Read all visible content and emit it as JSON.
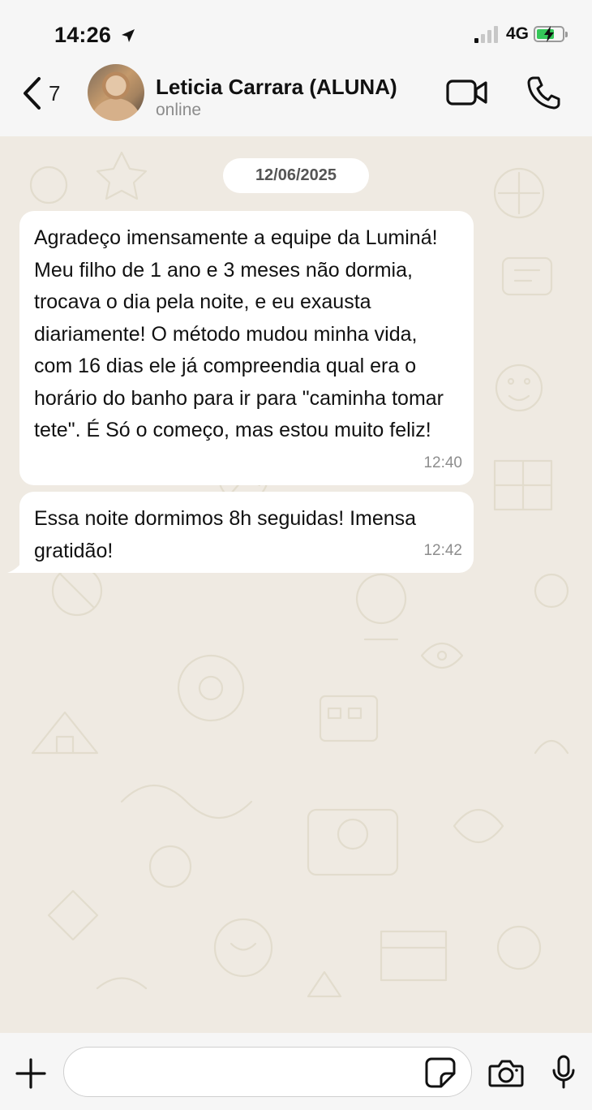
{
  "status_bar": {
    "time": "14:26",
    "network": "4G"
  },
  "header": {
    "back_count": "7",
    "contact_name": "Leticia Carrara (ALUNA)",
    "contact_status": "online"
  },
  "chat": {
    "date": "12/06/2025",
    "messages": [
      {
        "text": "Agradeço imensamente a equipe da Luminá! Meu filho de 1 ano e 3 meses não dormia, trocava o dia pela noite, e eu exausta diariamente! O método mudou minha vida, com 16 dias ele já compreendia qual era o horário do banho para ir para \"caminha tomar tete\". É Só o começo, mas estou muito feliz!",
        "time": "12:40"
      },
      {
        "text": "Essa noite dormimos 8h seguidas! Imensa gratidão!",
        "time": "12:42"
      }
    ]
  },
  "input": {
    "placeholder": ""
  },
  "icons": [
    "location-arrow-icon",
    "signal-icon",
    "battery-charging-icon",
    "back-chevron-icon",
    "video-call-icon",
    "phone-icon",
    "plus-icon",
    "sticker-icon",
    "camera-icon",
    "mic-icon"
  ],
  "colors": {
    "chat_background": "#efeae2",
    "bubble": "#ffffff",
    "battery_green": "#35c759",
    "time_gray": "#8d8d8d"
  }
}
